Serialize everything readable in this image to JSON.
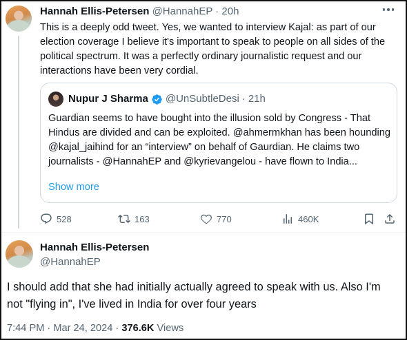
{
  "tweet": {
    "author_name": "Hannah Ellis-Petersen",
    "author_handle": "@HannahEP",
    "separator": "·",
    "time_ago": "20h",
    "text": "This is a deeply odd tweet. Yes, we wanted to interview Kajal: as part of our election coverage I believe it's important to speak to people on all sides of the political spectrum. It was a perfectly ordinary journalistic request and our interactions have been very cordial.",
    "quoted": {
      "author_name": "Nupur J Sharma",
      "author_handle": "@UnSubtleDesi",
      "time_ago": "21h",
      "text": "Guardian seems to have bought into the illusion sold by Congress - That Hindus are divided and can be exploited. @ahmermkhan has been hounding @kajal_jaihind for an “interview” on behalf of Gaurdian. He claims two journalists - @HannahEP and @kyrievangelou - have flown to India...",
      "show_more_label": "Show more"
    },
    "actions": {
      "replies": "528",
      "retweets": "163",
      "likes": "770",
      "views": "460K"
    }
  },
  "reply": {
    "author_name": "Hannah Ellis-Petersen",
    "author_handle": "@HannahEP",
    "text": "I should add that she had initially actually agreed to speak with us. Also I'm not \"flying in\", I've lived in India for over four years",
    "time": "7:44 PM",
    "separator": "·",
    "date": "Mar 24, 2024",
    "views_count": "376.6K",
    "views_label": "Views"
  },
  "colors": {
    "accent": "#1d9bf0",
    "muted": "#536471",
    "text": "#0f1419",
    "border": "#cfd9de"
  },
  "icons": [
    "more-icon",
    "verified-badge-icon",
    "reply-icon",
    "retweet-icon",
    "like-icon",
    "views-icon",
    "bookmark-icon",
    "share-icon"
  ]
}
